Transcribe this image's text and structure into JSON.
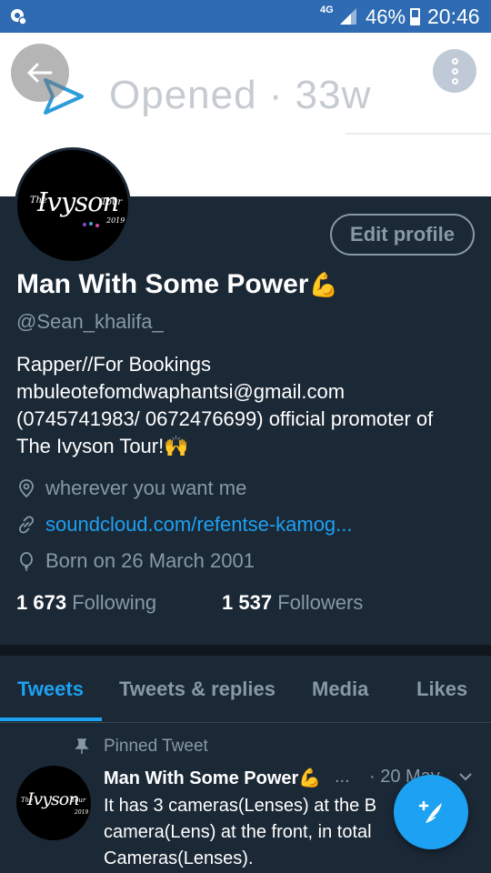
{
  "status_bar": {
    "network": "4G",
    "battery": "46%",
    "time": "20:46"
  },
  "banner": {
    "text": "Opened · 33w"
  },
  "profile": {
    "avatar_text": {
      "the": "The",
      "name": "Ivyson",
      "tour": "Tour",
      "year": "2019"
    },
    "edit_profile_label": "Edit profile",
    "display_name": "Man With Some Power",
    "name_emoji": "💪",
    "handle": "@Sean_khalifa_",
    "bio_lines": [
      "Rapper//For Bookings",
      "mbuleotefomdwaphantsi@gmail.com",
      "(0745741983/ 0672476699)  official promoter of",
      "The Ivyson Tour!"
    ],
    "bio_emoji": "🙌",
    "location": "wherever you want me",
    "website": "soundcloud.com/refentse-kamog...",
    "birthday": "Born on 26 March 2001",
    "following_count": "1 673",
    "following_label": "Following",
    "followers_count": "1 537",
    "followers_label": "Followers"
  },
  "tabs": [
    {
      "label": "Tweets",
      "active": true
    },
    {
      "label": "Tweets & replies",
      "active": false
    },
    {
      "label": "Media",
      "active": false
    },
    {
      "label": "Likes",
      "active": false
    }
  ],
  "pinned_tweet": {
    "pinned_label": "Pinned Tweet",
    "author": "Man With Some Power",
    "author_emoji": "💪",
    "ellipsis": "...",
    "date": "· 20 May",
    "text_lines": [
      "It has 3 cameras(Lenses) at the B",
      "camera(Lens) at the front, in total",
      "Cameras(Lenses)."
    ]
  },
  "colors": {
    "background": "#1b2836",
    "accent": "#1da1f2",
    "secondary_text": "#8899a6",
    "status_bar": "#2e6bb3"
  },
  "icons": {
    "back": "back-arrow-icon",
    "more": "more-vertical-icon",
    "location": "location-pin-icon",
    "link": "link-icon",
    "birthday": "balloon-icon",
    "pin": "pin-icon",
    "compose": "compose-feather-icon"
  }
}
